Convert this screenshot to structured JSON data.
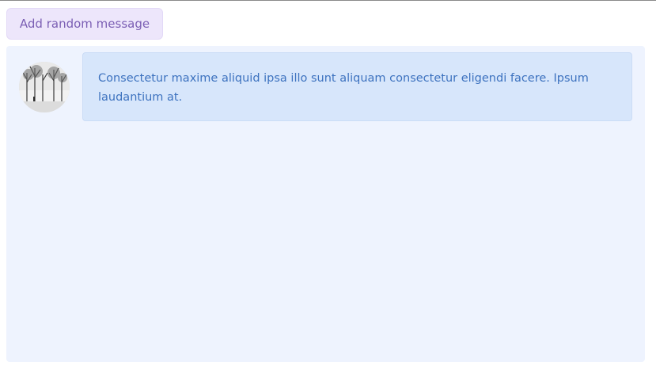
{
  "toolbar": {
    "add_button_label": "Add random message"
  },
  "messages": [
    {
      "avatar_icon": "winter-trees-photo",
      "text": "Consectetur maxime aliquid ipsa illo sunt aliquam consectetur eligendi facere. Ipsum laudantium at."
    }
  ],
  "colors": {
    "button_bg": "#ede6fb",
    "button_text": "#7b5fb4",
    "panel_bg": "#eef3fe",
    "bubble_bg": "#d7e6fb",
    "bubble_text": "#3d72bf"
  }
}
